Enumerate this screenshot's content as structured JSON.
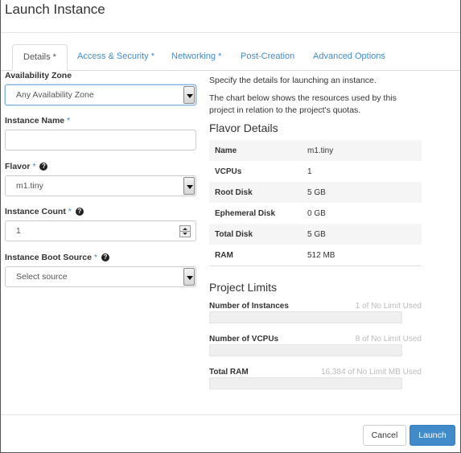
{
  "modal": {
    "title": "Launch Instance"
  },
  "tabs": [
    {
      "label": "Details *"
    },
    {
      "label": "Access & Security *"
    },
    {
      "label": "Networking *"
    },
    {
      "label": "Post-Creation"
    },
    {
      "label": "Advanced Options"
    }
  ],
  "form": {
    "availability_zone": {
      "label": "Availability Zone",
      "value": "Any Availability Zone"
    },
    "instance_name": {
      "label": "Instance Name",
      "required_mark": "*",
      "value": ""
    },
    "flavor": {
      "label": "Flavor",
      "required_mark": "*",
      "value": "m1.tiny"
    },
    "instance_count": {
      "label": "Instance Count",
      "required_mark": "*",
      "value": "1"
    },
    "boot_source": {
      "label": "Instance Boot Source",
      "required_mark": "*",
      "value": "Select source"
    },
    "help_glyph": "?"
  },
  "info": {
    "description_1": "Specify the details for launching an instance.",
    "description_2": "The chart below shows the resources used by this project in relation to the project's quotas."
  },
  "flavor_details": {
    "title": "Flavor Details",
    "rows": [
      {
        "key": "Name",
        "value": "m1.tiny"
      },
      {
        "key": "VCPUs",
        "value": "1"
      },
      {
        "key": "Root Disk",
        "value": "5 GB"
      },
      {
        "key": "Ephemeral Disk",
        "value": "0 GB"
      },
      {
        "key": "Total Disk",
        "value": "5 GB"
      },
      {
        "key": "RAM",
        "value": "512 MB"
      }
    ]
  },
  "project_limits": {
    "title": "Project Limits",
    "items": [
      {
        "name": "Number of Instances",
        "used": "1 of No Limit Used",
        "fraction": 0
      },
      {
        "name": "Number of VCPUs",
        "used": "8 of No Limit Used",
        "fraction": 0
      },
      {
        "name": "Total RAM",
        "used": "16,384 of No Limit MB Used",
        "fraction": 0
      }
    ]
  },
  "footer": {
    "cancel_label": "Cancel",
    "launch_label": "Launch"
  }
}
